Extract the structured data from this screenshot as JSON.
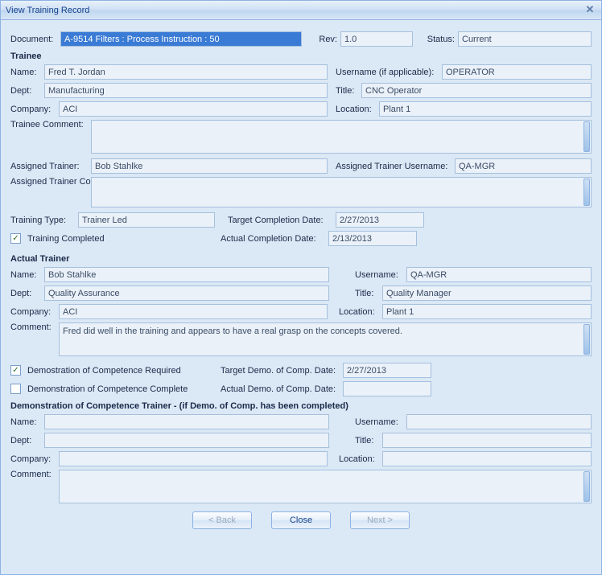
{
  "window": {
    "title": "View Training Record"
  },
  "top": {
    "document_label": "Document:",
    "document_value": "A-9514 Filters : Process Instruction : 50",
    "rev_label": "Rev:",
    "rev_value": "1.0",
    "status_label": "Status:",
    "status_value": "Current"
  },
  "trainee": {
    "section": "Trainee",
    "name_label": "Name:",
    "name": "Fred T. Jordan",
    "username_label": "Username (if applicable):",
    "username": "OPERATOR",
    "dept_label": "Dept:",
    "dept": "Manufacturing",
    "title_label": "Title:",
    "title": "CNC Operator",
    "company_label": "Company:",
    "company": "ACI",
    "location_label": "Location:",
    "location": "Plant 1",
    "comment_label": "Trainee Comment:",
    "comment": ""
  },
  "assigned": {
    "trainer_label": "Assigned Trainer:",
    "trainer": "Bob  Stahlke",
    "trainer_user_label": "Assigned Trainer Username:",
    "trainer_user": "QA-MGR",
    "comment_label": "Assigned Trainer Comment:",
    "comment": ""
  },
  "training": {
    "type_label": "Training Type:",
    "type": "Trainer Led",
    "target_label": "Target Completion Date:",
    "target": "2/27/2013",
    "completed_label": "Training Completed",
    "completed_checked": true,
    "actual_label": "Actual Completion Date:",
    "actual": "2/13/2013"
  },
  "actual_trainer": {
    "section": "Actual Trainer",
    "name_label": "Name:",
    "name": "Bob  Stahlke",
    "username_label": "Username:",
    "username": "QA-MGR",
    "dept_label": "Dept:",
    "dept": "Quality Assurance",
    "title_label": "Title:",
    "title": "Quality Manager",
    "company_label": "Company:",
    "company": "ACI",
    "location_label": "Location:",
    "location": "Plant 1",
    "comment_label": "Comment:",
    "comment": "Fred did well in the training and appears to have a real grasp on the concepts covered."
  },
  "demo": {
    "req_label": "Demostration of Competence Required",
    "req_checked": true,
    "target_label": "Target Demo. of Comp. Date:",
    "target": "2/27/2013",
    "complete_label": "Demonstration of Competence Complete",
    "complete_checked": false,
    "actual_label": "Actual Demo. of Comp. Date:",
    "actual": ""
  },
  "demo_trainer": {
    "section": "Demonstration of Competence Trainer - (if Demo. of Comp. has been completed)",
    "name_label": "Name:",
    "name": "",
    "username_label": "Username:",
    "username": "",
    "dept_label": "Dept:",
    "dept": "",
    "title_label": "Title:",
    "title": "",
    "company_label": "Company:",
    "company": "",
    "location_label": "Location:",
    "location": "",
    "comment_label": "Comment:",
    "comment": ""
  },
  "buttons": {
    "back": "< Back",
    "close": "Close",
    "next": "Next >"
  },
  "glyphs": {
    "check": "✓",
    "x": "✕"
  }
}
